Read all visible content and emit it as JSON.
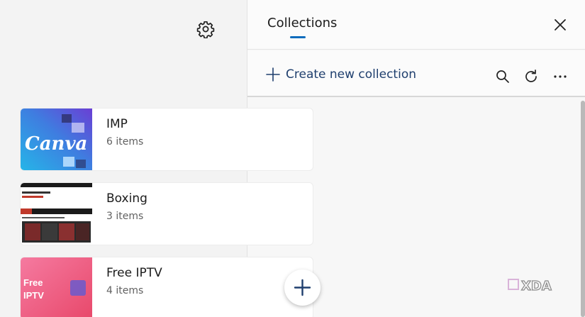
{
  "settings": {
    "icon": "gear-icon"
  },
  "panel": {
    "title": "Collections",
    "close_icon": "close-icon"
  },
  "toolbar": {
    "create_label": "Create new collection",
    "icons": [
      "search-icon",
      "refresh-icon",
      "more-options-icon"
    ]
  },
  "collections": [
    {
      "name": "IMP",
      "count": "6 items",
      "thumb_text": "Canva"
    },
    {
      "name": "Boxing",
      "count": "3 items"
    },
    {
      "name": "Free IPTV",
      "count": "4 items",
      "thumb_text": "Free\nIPTV"
    }
  ],
  "fab": {
    "icon": "plus-icon"
  },
  "watermark": {
    "text": "XDA"
  },
  "colors": {
    "accent": "#0f6cbd",
    "link": "#1f3f6e"
  }
}
